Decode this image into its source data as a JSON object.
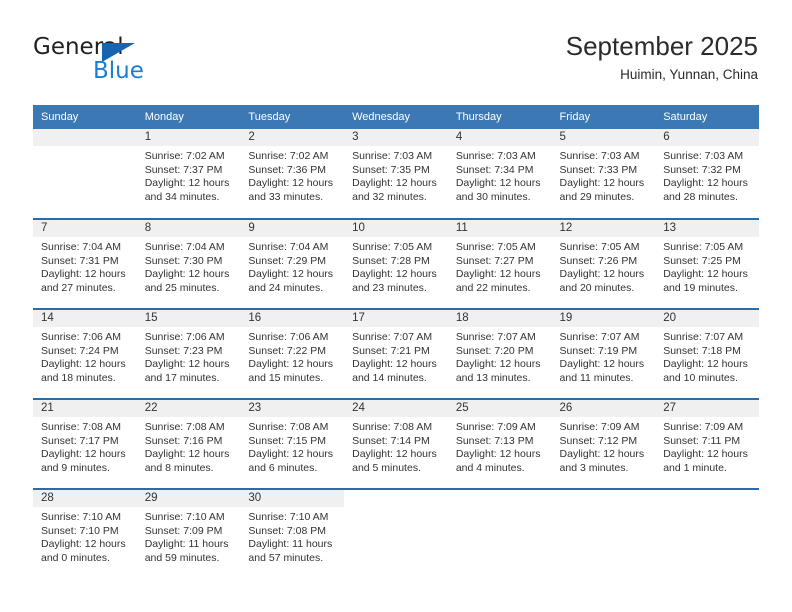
{
  "logo": {
    "word1": "General",
    "word2": "Blue",
    "triangle_color": "#1565b0",
    "blue_color": "#1a7fd4"
  },
  "header": {
    "title": "September 2025",
    "subtitle": "Huimin, Yunnan, China"
  },
  "theme": {
    "header_bg": "#3b78b4",
    "week_divider": "#2a6ca8",
    "daynum_bg": "#f0f0f0"
  },
  "weekdays": [
    "Sunday",
    "Monday",
    "Tuesday",
    "Wednesday",
    "Thursday",
    "Friday",
    "Saturday"
  ],
  "labels": {
    "sunrise": "Sunrise:",
    "sunset": "Sunset:",
    "daylight": "Daylight:"
  },
  "weeks": [
    [
      {
        "day": "",
        "blank": true,
        "line1": "",
        "line2": "",
        "line3": "",
        "line4": ""
      },
      {
        "day": "1",
        "line1": "Sunrise: 7:02 AM",
        "line2": "Sunset: 7:37 PM",
        "line3": "Daylight: 12 hours",
        "line4": "and 34 minutes."
      },
      {
        "day": "2",
        "line1": "Sunrise: 7:02 AM",
        "line2": "Sunset: 7:36 PM",
        "line3": "Daylight: 12 hours",
        "line4": "and 33 minutes."
      },
      {
        "day": "3",
        "line1": "Sunrise: 7:03 AM",
        "line2": "Sunset: 7:35 PM",
        "line3": "Daylight: 12 hours",
        "line4": "and 32 minutes."
      },
      {
        "day": "4",
        "line1": "Sunrise: 7:03 AM",
        "line2": "Sunset: 7:34 PM",
        "line3": "Daylight: 12 hours",
        "line4": "and 30 minutes."
      },
      {
        "day": "5",
        "line1": "Sunrise: 7:03 AM",
        "line2": "Sunset: 7:33 PM",
        "line3": "Daylight: 12 hours",
        "line4": "and 29 minutes."
      },
      {
        "day": "6",
        "line1": "Sunrise: 7:03 AM",
        "line2": "Sunset: 7:32 PM",
        "line3": "Daylight: 12 hours",
        "line4": "and 28 minutes."
      }
    ],
    [
      {
        "day": "7",
        "line1": "Sunrise: 7:04 AM",
        "line2": "Sunset: 7:31 PM",
        "line3": "Daylight: 12 hours",
        "line4": "and 27 minutes."
      },
      {
        "day": "8",
        "line1": "Sunrise: 7:04 AM",
        "line2": "Sunset: 7:30 PM",
        "line3": "Daylight: 12 hours",
        "line4": "and 25 minutes."
      },
      {
        "day": "9",
        "line1": "Sunrise: 7:04 AM",
        "line2": "Sunset: 7:29 PM",
        "line3": "Daylight: 12 hours",
        "line4": "and 24 minutes."
      },
      {
        "day": "10",
        "line1": "Sunrise: 7:05 AM",
        "line2": "Sunset: 7:28 PM",
        "line3": "Daylight: 12 hours",
        "line4": "and 23 minutes."
      },
      {
        "day": "11",
        "line1": "Sunrise: 7:05 AM",
        "line2": "Sunset: 7:27 PM",
        "line3": "Daylight: 12 hours",
        "line4": "and 22 minutes."
      },
      {
        "day": "12",
        "line1": "Sunrise: 7:05 AM",
        "line2": "Sunset: 7:26 PM",
        "line3": "Daylight: 12 hours",
        "line4": "and 20 minutes."
      },
      {
        "day": "13",
        "line1": "Sunrise: 7:05 AM",
        "line2": "Sunset: 7:25 PM",
        "line3": "Daylight: 12 hours",
        "line4": "and 19 minutes."
      }
    ],
    [
      {
        "day": "14",
        "line1": "Sunrise: 7:06 AM",
        "line2": "Sunset: 7:24 PM",
        "line3": "Daylight: 12 hours",
        "line4": "and 18 minutes."
      },
      {
        "day": "15",
        "line1": "Sunrise: 7:06 AM",
        "line2": "Sunset: 7:23 PM",
        "line3": "Daylight: 12 hours",
        "line4": "and 17 minutes."
      },
      {
        "day": "16",
        "line1": "Sunrise: 7:06 AM",
        "line2": "Sunset: 7:22 PM",
        "line3": "Daylight: 12 hours",
        "line4": "and 15 minutes."
      },
      {
        "day": "17",
        "line1": "Sunrise: 7:07 AM",
        "line2": "Sunset: 7:21 PM",
        "line3": "Daylight: 12 hours",
        "line4": "and 14 minutes."
      },
      {
        "day": "18",
        "line1": "Sunrise: 7:07 AM",
        "line2": "Sunset: 7:20 PM",
        "line3": "Daylight: 12 hours",
        "line4": "and 13 minutes."
      },
      {
        "day": "19",
        "line1": "Sunrise: 7:07 AM",
        "line2": "Sunset: 7:19 PM",
        "line3": "Daylight: 12 hours",
        "line4": "and 11 minutes."
      },
      {
        "day": "20",
        "line1": "Sunrise: 7:07 AM",
        "line2": "Sunset: 7:18 PM",
        "line3": "Daylight: 12 hours",
        "line4": "and 10 minutes."
      }
    ],
    [
      {
        "day": "21",
        "line1": "Sunrise: 7:08 AM",
        "line2": "Sunset: 7:17 PM",
        "line3": "Daylight: 12 hours",
        "line4": "and 9 minutes."
      },
      {
        "day": "22",
        "line1": "Sunrise: 7:08 AM",
        "line2": "Sunset: 7:16 PM",
        "line3": "Daylight: 12 hours",
        "line4": "and 8 minutes."
      },
      {
        "day": "23",
        "line1": "Sunrise: 7:08 AM",
        "line2": "Sunset: 7:15 PM",
        "line3": "Daylight: 12 hours",
        "line4": "and 6 minutes."
      },
      {
        "day": "24",
        "line1": "Sunrise: 7:08 AM",
        "line2": "Sunset: 7:14 PM",
        "line3": "Daylight: 12 hours",
        "line4": "and 5 minutes."
      },
      {
        "day": "25",
        "line1": "Sunrise: 7:09 AM",
        "line2": "Sunset: 7:13 PM",
        "line3": "Daylight: 12 hours",
        "line4": "and 4 minutes."
      },
      {
        "day": "26",
        "line1": "Sunrise: 7:09 AM",
        "line2": "Sunset: 7:12 PM",
        "line3": "Daylight: 12 hours",
        "line4": "and 3 minutes."
      },
      {
        "day": "27",
        "line1": "Sunrise: 7:09 AM",
        "line2": "Sunset: 7:11 PM",
        "line3": "Daylight: 12 hours",
        "line4": "and 1 minute."
      }
    ],
    [
      {
        "day": "28",
        "line1": "Sunrise: 7:10 AM",
        "line2": "Sunset: 7:10 PM",
        "line3": "Daylight: 12 hours",
        "line4": "and 0 minutes."
      },
      {
        "day": "29",
        "line1": "Sunrise: 7:10 AM",
        "line2": "Sunset: 7:09 PM",
        "line3": "Daylight: 11 hours",
        "line4": "and 59 minutes."
      },
      {
        "day": "30",
        "line1": "Sunrise: 7:10 AM",
        "line2": "Sunset: 7:08 PM",
        "line3": "Daylight: 11 hours",
        "line4": "and 57 minutes."
      },
      {
        "day": "",
        "empty": true,
        "line1": "",
        "line2": "",
        "line3": "",
        "line4": ""
      },
      {
        "day": "",
        "empty": true,
        "line1": "",
        "line2": "",
        "line3": "",
        "line4": ""
      },
      {
        "day": "",
        "empty": true,
        "line1": "",
        "line2": "",
        "line3": "",
        "line4": ""
      },
      {
        "day": "",
        "empty": true,
        "line1": "",
        "line2": "",
        "line3": "",
        "line4": ""
      }
    ]
  ]
}
